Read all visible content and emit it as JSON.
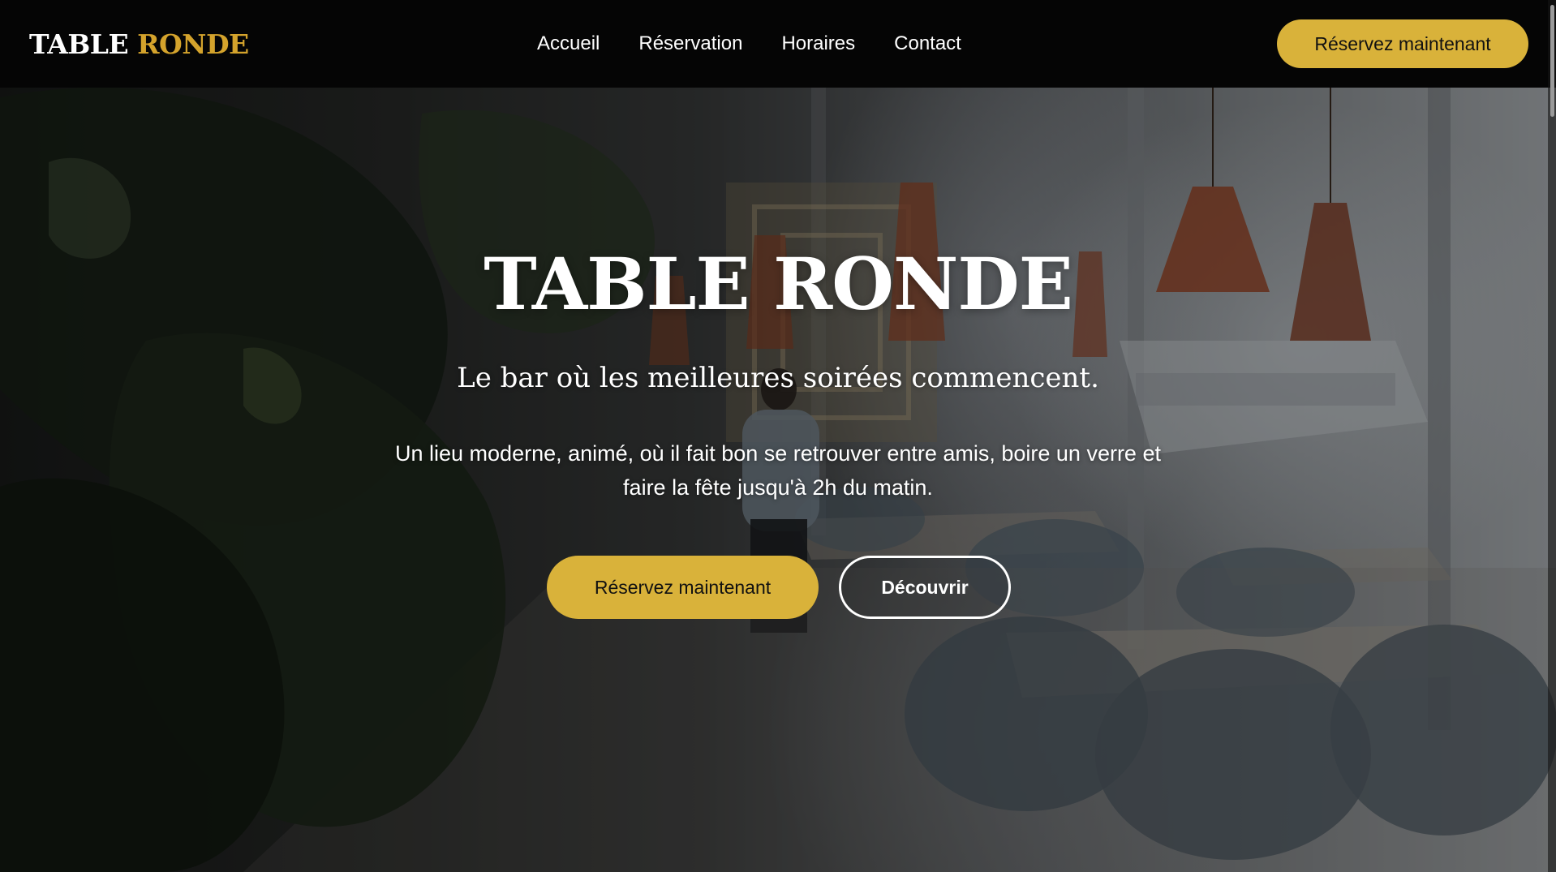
{
  "colors": {
    "accent_gold": "#d4a32c",
    "button_gold": "#d9b23a",
    "navbar_bg": "#050505",
    "text_light": "#ffffff",
    "text_dark": "#111111"
  },
  "navbar": {
    "logo": {
      "primary": "TABLE",
      "accent": "RONDE"
    },
    "links": [
      {
        "label": "Accueil"
      },
      {
        "label": "Réservation"
      },
      {
        "label": "Horaires"
      },
      {
        "label": "Contact"
      }
    ],
    "cta_label": "Réservez maintenant"
  },
  "hero": {
    "title": "TABLE RONDE",
    "subtitle": "Le bar où les meilleures soirées commencent.",
    "description": "Un lieu moderne, animé, où il fait bon se retrouver entre amis, boire un verre et faire la fête jusqu'à 2h du matin.",
    "primary_button_label": "Réservez maintenant",
    "secondary_button_label": "Découvrir"
  }
}
